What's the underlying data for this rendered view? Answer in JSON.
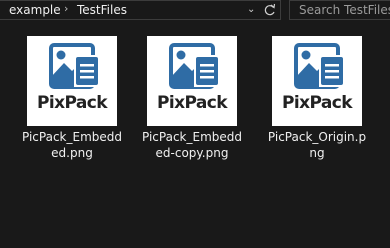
{
  "breadcrumb": {
    "items": [
      "example",
      "TestFiles"
    ]
  },
  "search": {
    "placeholder": "Search TestFiles"
  },
  "files": [
    {
      "name_line1": "PicPack_Embedd",
      "name_line2": "ed.png",
      "thumb_text": "PixPack"
    },
    {
      "name_line1": "PicPack_Embedd",
      "name_line2": "ed-copy.png",
      "thumb_text": "PixPack"
    },
    {
      "name_line1": "PicPack_Origin.p",
      "name_line2": "ng",
      "thumb_text": "PixPack"
    }
  ],
  "colors": {
    "logo_blue": "#2f6ca5",
    "background": "#191919"
  }
}
